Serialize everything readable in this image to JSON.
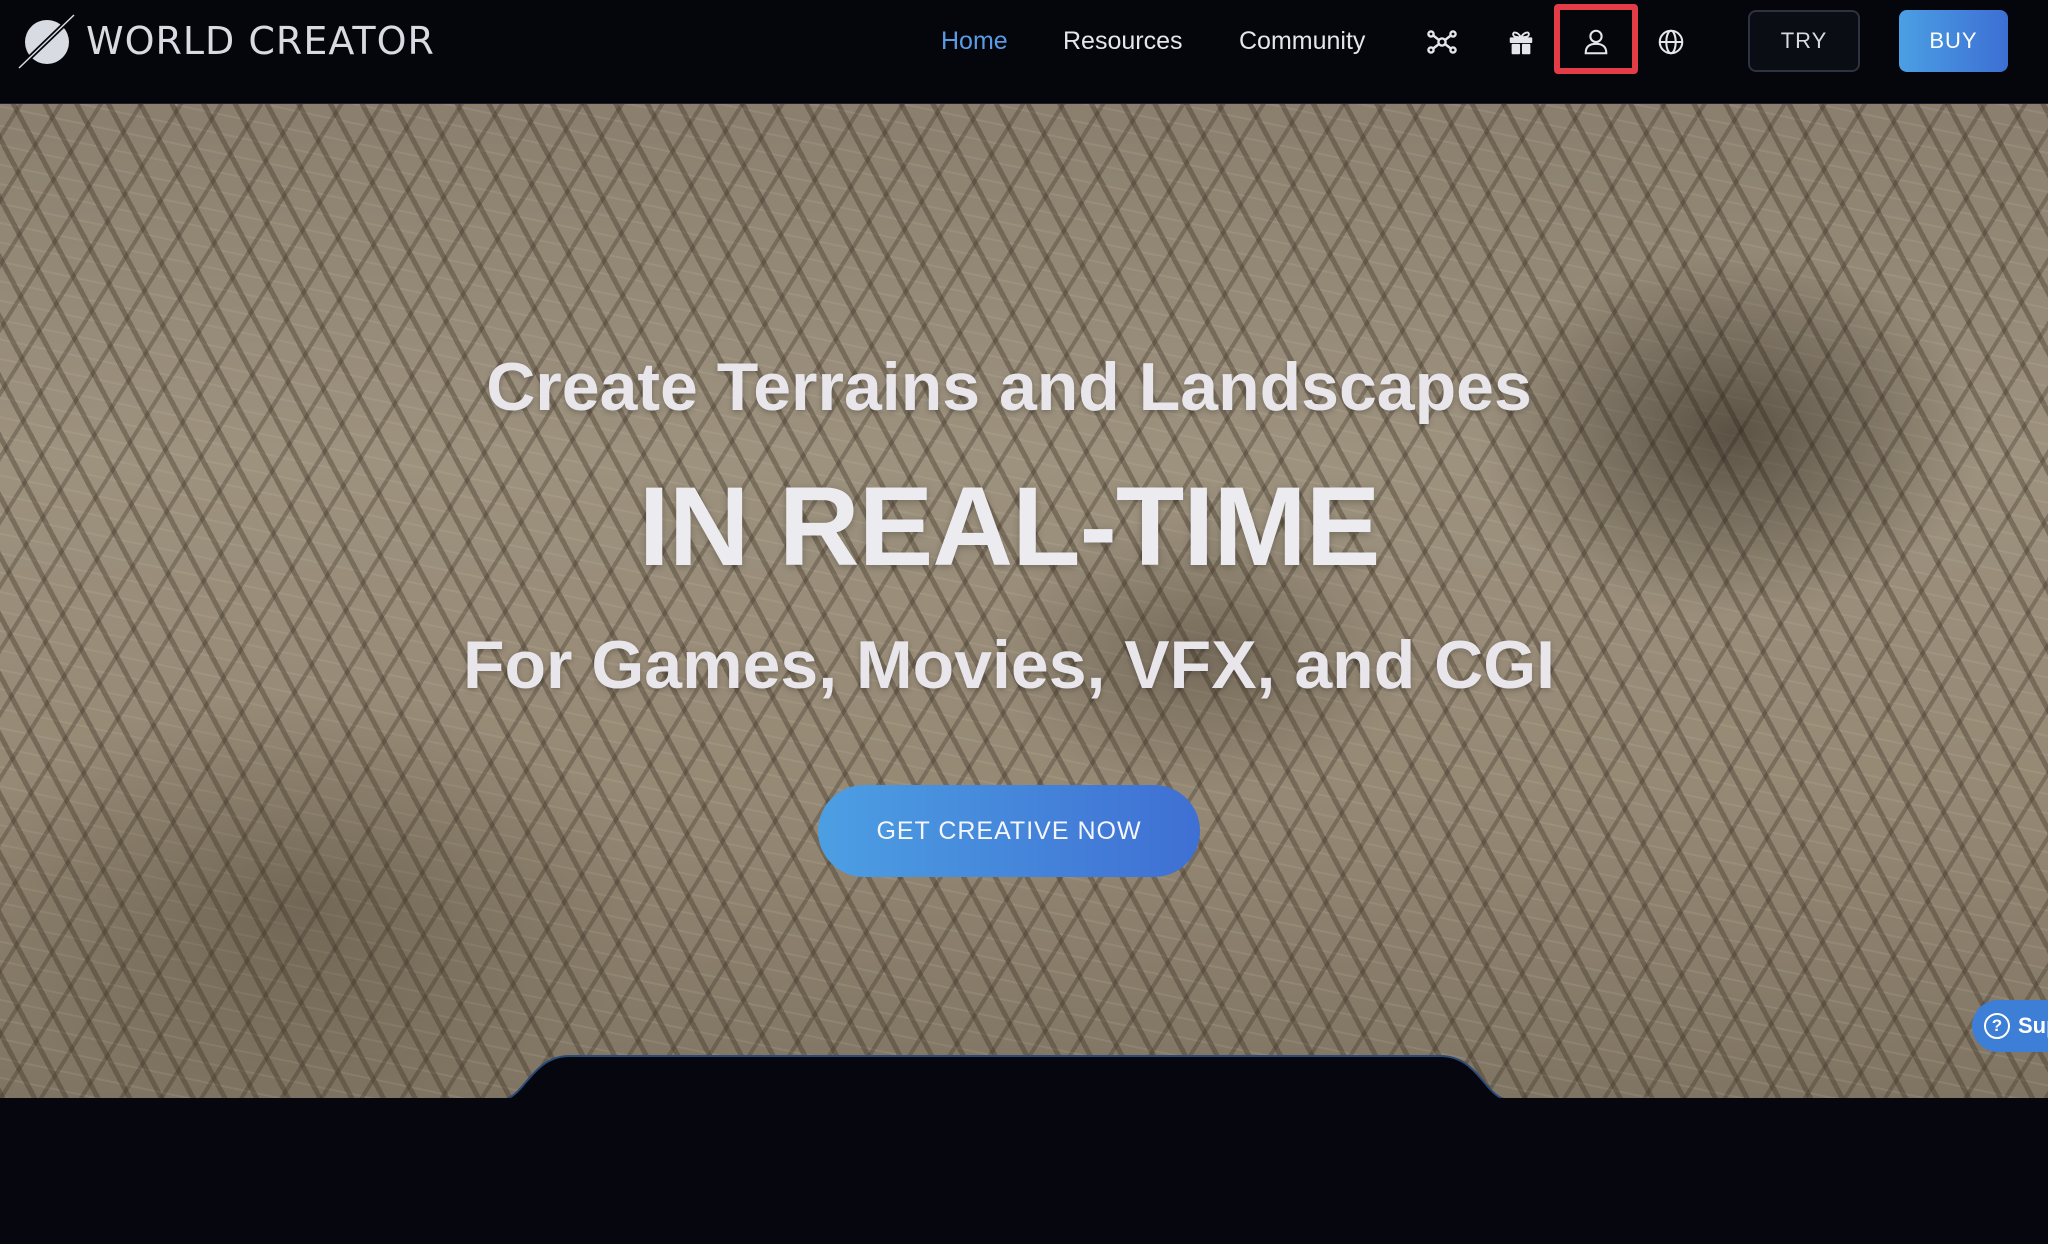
{
  "brand": {
    "name": "WORLD CREATOR"
  },
  "nav": {
    "links": [
      {
        "label": "Home",
        "active": true
      },
      {
        "label": "Resources",
        "active": false
      },
      {
        "label": "Community",
        "active": false
      }
    ],
    "icons": [
      "network-icon",
      "gift-icon",
      "user-icon",
      "globe-icon"
    ],
    "try_label": "TRY",
    "buy_label": "BUY"
  },
  "hero": {
    "line1": "Create Terrains and Landscapes",
    "line2": "IN REAL-TIME",
    "line3": "For Games, Movies, VFX, and CGI",
    "cta_label": "GET CREATIVE NOW"
  },
  "support": {
    "label": "Sup"
  },
  "colors": {
    "accent": "#5a9be6",
    "button_gradient_start": "#4b9fe4",
    "button_gradient_end": "#3d6fd4",
    "highlight": "#e23c46",
    "background": "#05060e"
  }
}
